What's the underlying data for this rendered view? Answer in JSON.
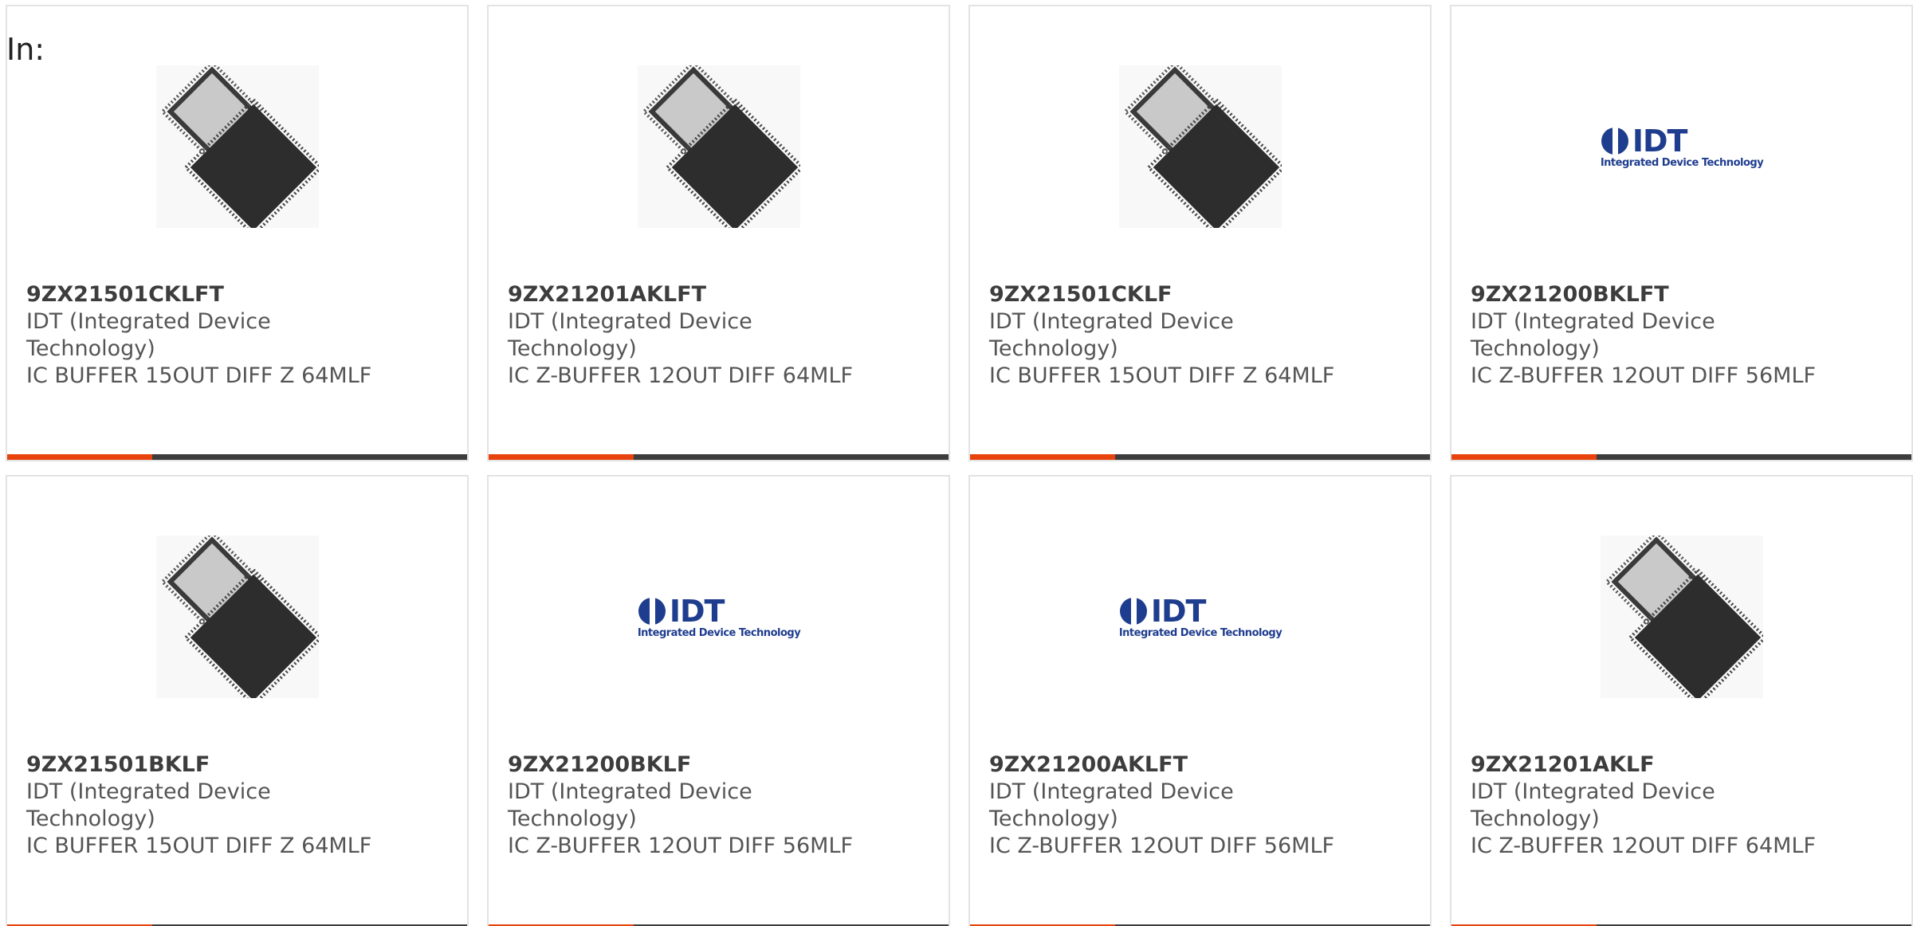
{
  "header": {
    "label": "In:"
  },
  "products": [
    {
      "part_number": "9ZX21501CKLFT",
      "manufacturer": "IDT (Integrated Device Technology)",
      "description": "IC BUFFER 15OUT DIFF Z 64MLF",
      "image": "chip-image"
    },
    {
      "part_number": "9ZX21201AKLFT",
      "manufacturer": "IDT (Integrated Device Technology)",
      "description": "IC Z-BUFFER 12OUT DIFF 64MLF",
      "image": "chip-image"
    },
    {
      "part_number": "9ZX21501CKLF",
      "manufacturer": "IDT (Integrated Device Technology)",
      "description": "IC BUFFER 15OUT DIFF Z 64MLF",
      "image": "chip-image"
    },
    {
      "part_number": "9ZX21200BKLFT",
      "manufacturer": "IDT (Integrated Device Technology)",
      "description": "IC Z-BUFFER 12OUT DIFF 56MLF",
      "image": "idt-logo"
    },
    {
      "part_number": "9ZX21501BKLF",
      "manufacturer": "IDT (Integrated Device Technology)",
      "description": "IC BUFFER 15OUT DIFF Z 64MLF",
      "image": "chip-image"
    },
    {
      "part_number": "9ZX21200BKLF",
      "manufacturer": "IDT (Integrated Device Technology)",
      "description": "IC Z-BUFFER 12OUT DIFF 56MLF",
      "image": "idt-logo"
    },
    {
      "part_number": "9ZX21200AKLFT",
      "manufacturer": "IDT (Integrated Device Technology)",
      "description": "IC Z-BUFFER 12OUT DIFF 56MLF",
      "image": "idt-logo"
    },
    {
      "part_number": "9ZX21201AKLF",
      "manufacturer": "IDT (Integrated Device Technology)",
      "description": "IC Z-BUFFER 12OUT DIFF 64MLF",
      "image": "chip-image"
    }
  ],
  "logo": {
    "wordmark": "IDT",
    "tagline": "Integrated Device Technology"
  },
  "colors": {
    "accent": "#e8420e",
    "bar": "#3d3d3d",
    "logo": "#1f3d8f"
  }
}
